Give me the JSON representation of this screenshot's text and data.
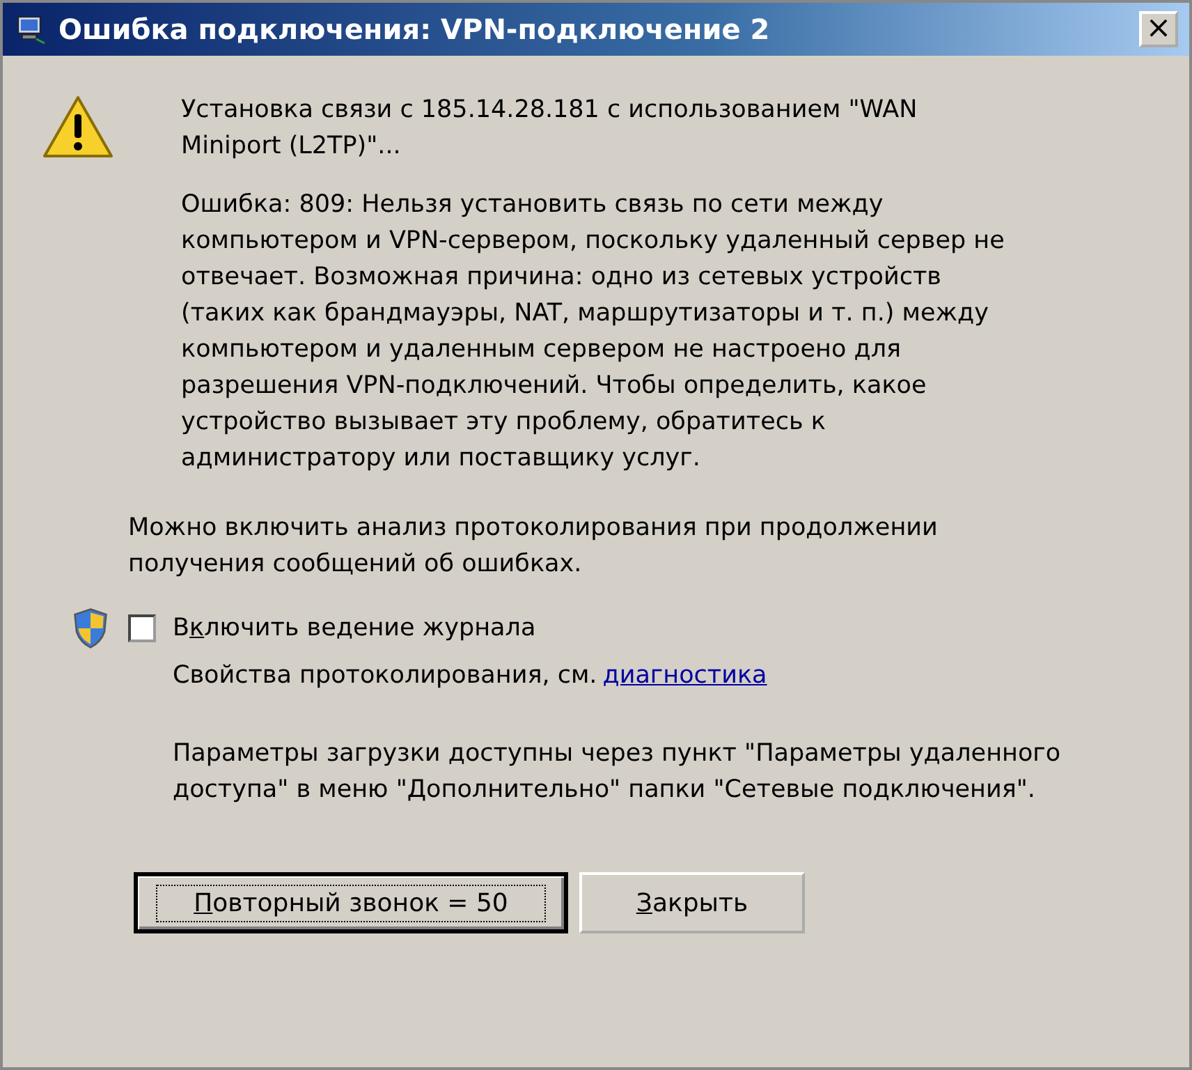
{
  "window": {
    "title": "Ошибка подключения: VPN-подключение 2",
    "close": "×"
  },
  "message": {
    "status": "Установка связи с 185.14.28.181 с использованием \"WAN Miniport (L2TP)\"...",
    "error": "Ошибка: 809: Нельзя установить связь по сети между компьютером и VPN-сервером, поскольку удаленный сервер не отвечает. Возможная причина: одно из сетевых устройств (таких как брандмауэры, NAT, маршрутизаторы и т. п.) между компьютером и удаленным сервером не настроено для разрешения VPN-подключений. Чтобы определить, какое устройство вызывает эту проблему, обратитесь к администратору или поставщику услуг."
  },
  "hint": "Можно включить анализ протоколирования при продолжении получения сообщений об ошибках.",
  "logging": {
    "label": {
      "before": "В",
      "key": "к",
      "after": "лючить ведение журнала"
    },
    "checked": false,
    "properties": "Свойства протоколирования, см.",
    "link": "диагностика"
  },
  "note": "Параметры загрузки доступны через пункт \"Параметры удаленного доступа\" в меню \"Дополнительно\" папки \"Сетевые подключения\".",
  "buttons": [
    {
      "label": {
        "key": "П",
        "after": "овторный звонок = 50"
      },
      "default": true
    },
    {
      "label": {
        "key": "З",
        "after": "акрыть"
      },
      "default": false
    }
  ]
}
